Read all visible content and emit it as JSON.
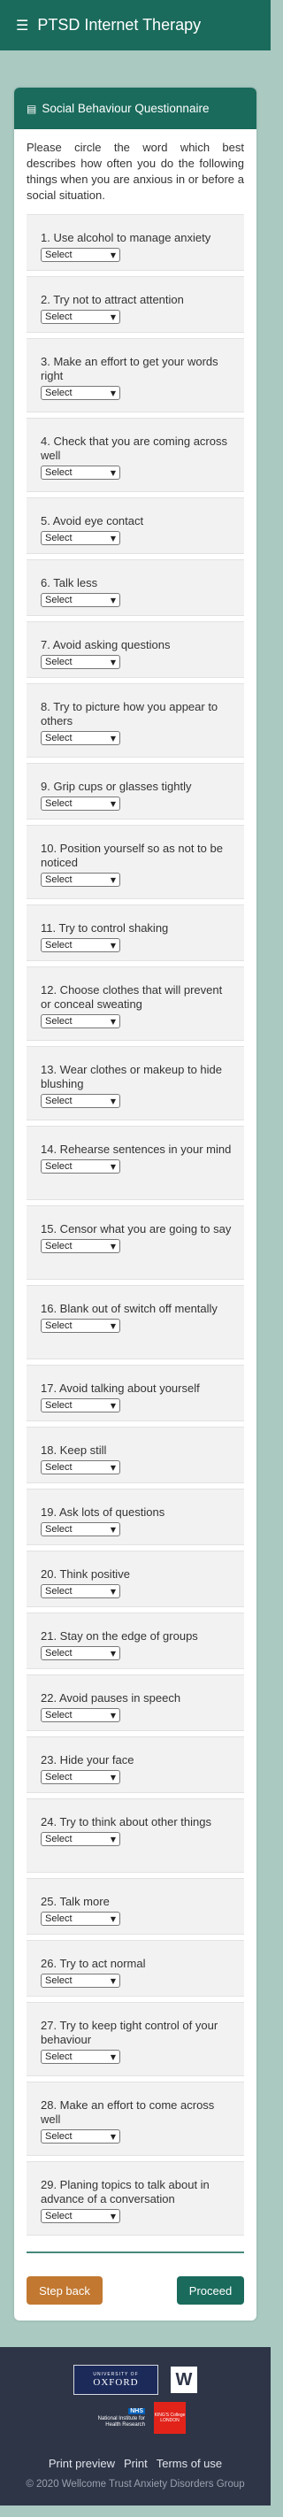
{
  "header": {
    "title": "PTSD Internet Therapy",
    "menu_icon": "menu-icon"
  },
  "card": {
    "title": "Social Behaviour Questionnaire",
    "intro": "Please circle the word which best describes how often you do the following things when you are anxious in or before a social situation."
  },
  "select_placeholder": "Select",
  "questions": [
    "1. Use alcohol to manage anxiety",
    "2. Try not to attract attention",
    "3. Make an effort to get your words right",
    "4. Check that you are coming across well",
    "5. Avoid eye contact",
    "6. Talk less",
    "7. Avoid asking questions",
    "8. Try to picture how you appear to others",
    "9. Grip cups or glasses tightly",
    "10. Position yourself so as not to be noticed",
    "11. Try to control shaking",
    "12. Choose clothes that will prevent or conceal sweating",
    "13. Wear clothes or makeup to hide blushing",
    "14. Rehearse sentences in your mind",
    "15. Censor what you are going to say",
    "16. Blank out of switch off mentally",
    "17. Avoid talking about yourself",
    "18. Keep still",
    "19. Ask lots of questions",
    "20. Think positive",
    "21. Stay on the edge of groups",
    "22. Avoid pauses in speech",
    "23. Hide your face",
    "24. Try to think about other things",
    "25. Talk more",
    "26. Try to act normal",
    "27. Try to keep tight control of your behaviour",
    "28. Make an effort to come across well",
    "29. Planing topics to talk about in advance of a conversation"
  ],
  "buttons": {
    "back": "Step back",
    "proceed": "Proceed"
  },
  "footer": {
    "oxford_top": "UNIVERSITY OF",
    "oxford_main": "OXFORD",
    "wellcome": "W",
    "nhs": "NHS",
    "nihr": "National Institute for Health Research",
    "kings": "KING'S College LONDON",
    "links": [
      "Print preview",
      "Print",
      "Terms of use"
    ],
    "copyright": "© 2020 Wellcome Trust Anxiety Disorders Group"
  }
}
